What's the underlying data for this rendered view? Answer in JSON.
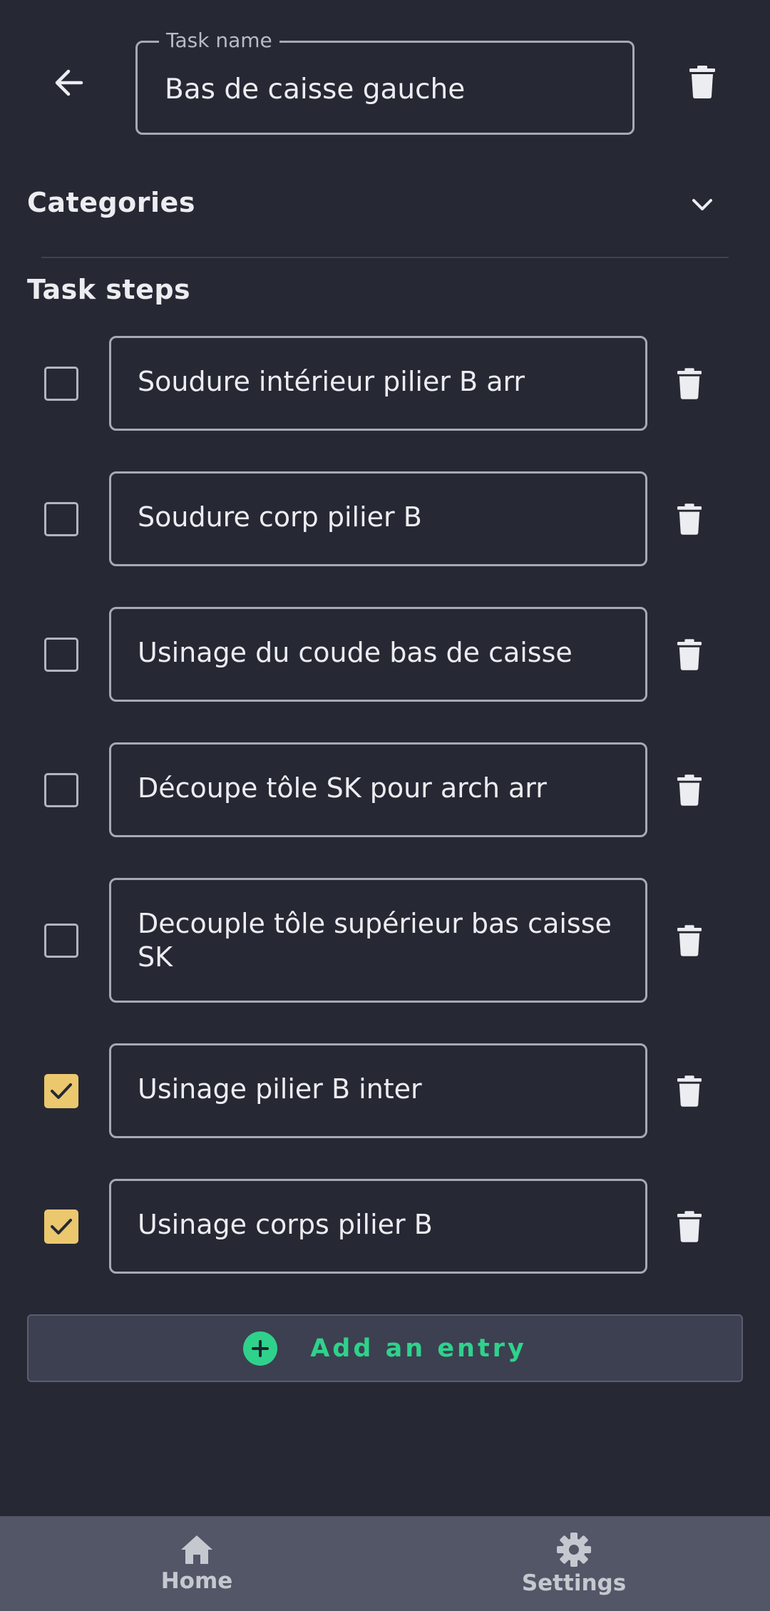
{
  "header": {
    "task_name_label": "Task name",
    "task_name_value": "Bas de caisse gauche",
    "back_icon": "arrow-left-icon",
    "delete_icon": "trash-icon"
  },
  "categories": {
    "title": "Categories",
    "chevron_icon": "chevron-down-icon"
  },
  "steps": {
    "title": "Task steps",
    "items": [
      {
        "label": "Soudure intérieur pilier B arr",
        "checked": false
      },
      {
        "label": "Soudure corp pilier B",
        "checked": false
      },
      {
        "label": "Usinage du coude bas de caisse",
        "checked": false
      },
      {
        "label": "Découpe tôle SK pour arch arr",
        "checked": false
      },
      {
        "label": "Decouple tôle supérieur bas caisse SK",
        "checked": false
      },
      {
        "label": "Usinage pilier B inter",
        "checked": true
      },
      {
        "label": "Usinage corps pilier B",
        "checked": true
      }
    ]
  },
  "add_entry": {
    "label": "Add an entry",
    "icon": "plus-circle-icon"
  },
  "bottom_nav": {
    "items": [
      {
        "label": "Home",
        "icon": "home-icon"
      },
      {
        "label": "Settings",
        "icon": "gear-icon"
      }
    ]
  },
  "colors": {
    "background": "#262834",
    "checked": "#ebc76e",
    "accent": "#2fd28b",
    "nav_background": "#535666"
  }
}
